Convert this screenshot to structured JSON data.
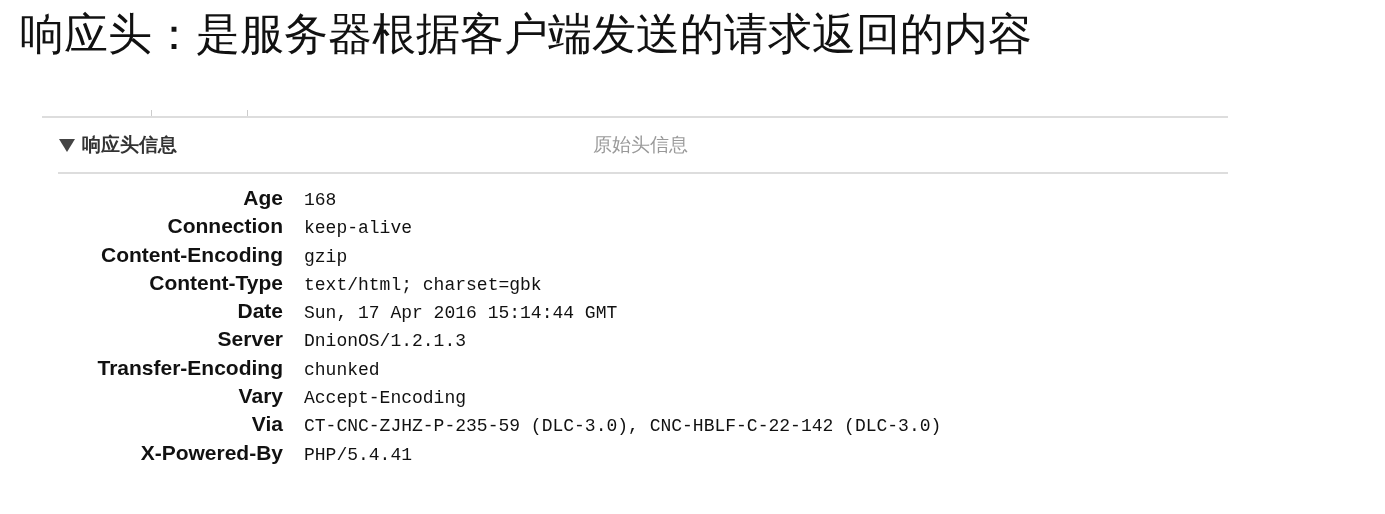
{
  "slide_title": "响应头：是服务器根据客户端发送的请求返回的内容",
  "section": {
    "title": "响应头信息",
    "expanded": true,
    "raw_link": "原始头信息"
  },
  "headers": [
    {
      "name": "Age",
      "value": "168"
    },
    {
      "name": "Connection",
      "value": "keep-alive"
    },
    {
      "name": "Content-Encoding",
      "value": "gzip"
    },
    {
      "name": "Content-Type",
      "value": "text/html; charset=gbk"
    },
    {
      "name": "Date",
      "value": "Sun, 17 Apr 2016 15:14:44 GMT"
    },
    {
      "name": "Server",
      "value": "DnionOS/1.2.1.3"
    },
    {
      "name": "Transfer-Encoding",
      "value": "chunked"
    },
    {
      "name": "Vary",
      "value": "Accept-Encoding"
    },
    {
      "name": "Via",
      "value": "CT-CNC-ZJHZ-P-235-59 (DLC-3.0), CNC-HBLF-C-22-142 (DLC-3.0)"
    },
    {
      "name": "X-Powered-By",
      "value": "PHP/5.4.41"
    }
  ]
}
